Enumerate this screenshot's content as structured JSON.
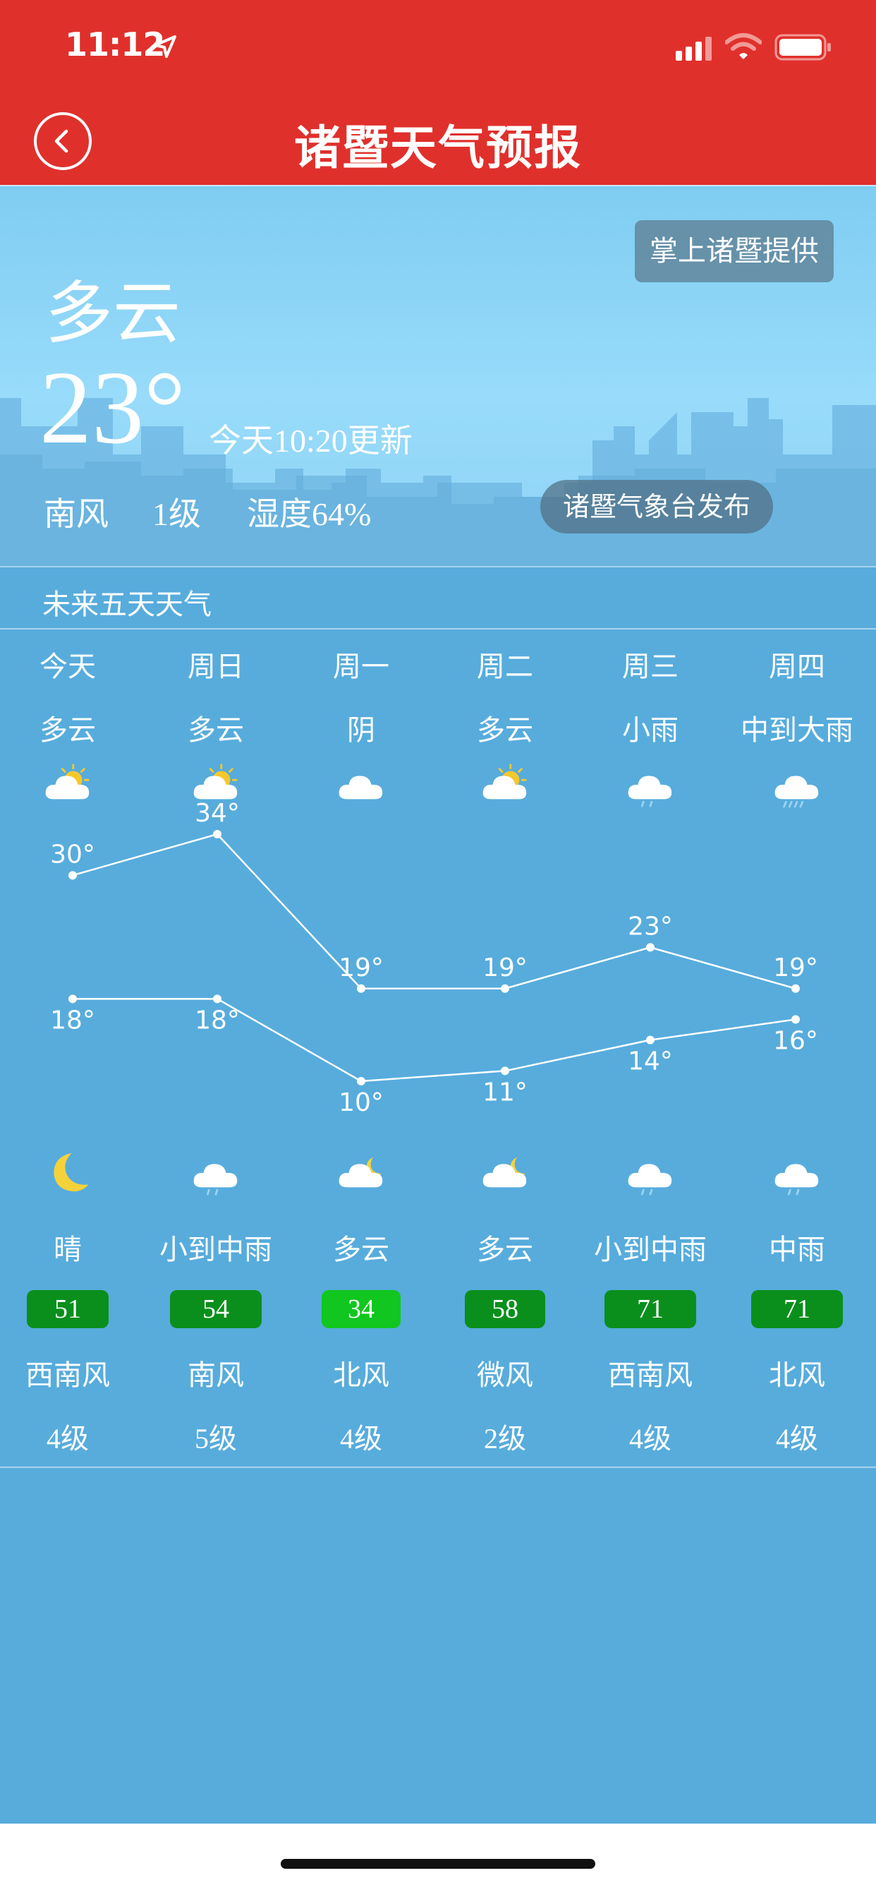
{
  "status_bar": {
    "time": "11:12",
    "location_icon": "location-arrow-icon",
    "signal_icon": "cellular-signal-icon",
    "wifi_icon": "wifi-icon",
    "battery_icon": "battery-icon"
  },
  "nav": {
    "title": "诸暨天气预报",
    "back_icon": "back-chevron-icon",
    "color": "#e0302c"
  },
  "current": {
    "condition": "多云",
    "temperature": "23°",
    "update_time": "今天10:20更新",
    "wind_direction": "南风",
    "wind_level": "1级",
    "humidity": "湿度64%",
    "provider": "掌上诸暨提供",
    "publisher": "诸暨气象台发布"
  },
  "forecast": {
    "section_title": "未来五天天气",
    "days": [
      {
        "name": "今天",
        "day_condition": "多云",
        "day_icon": "partly-cloudy-sun-icon",
        "night_icon": "crescent-moon-icon",
        "night_condition": "晴",
        "aqi": "51",
        "aqi_color": "#0a8f1c",
        "wind_direction": "西南风",
        "wind_level": "4级"
      },
      {
        "name": "周日",
        "day_condition": "多云",
        "day_icon": "partly-cloudy-sun-icon",
        "night_icon": "cloud-rain-icon",
        "night_condition": "小到中雨",
        "aqi": "54",
        "aqi_color": "#0a8f1c",
        "wind_direction": "南风",
        "wind_level": "5级"
      },
      {
        "name": "周一",
        "day_condition": "阴",
        "day_icon": "cloud-icon",
        "night_icon": "cloudy-night-icon",
        "night_condition": "多云",
        "aqi": "34",
        "aqi_color": "#11c61f",
        "wind_direction": "北风",
        "wind_level": "4级"
      },
      {
        "name": "周二",
        "day_condition": "多云",
        "day_icon": "partly-cloudy-sun-icon",
        "night_icon": "cloudy-night-icon",
        "night_condition": "多云",
        "aqi": "58",
        "aqi_color": "#0a8f1c",
        "wind_direction": "微风",
        "wind_level": "2级"
      },
      {
        "name": "周三",
        "day_condition": "小雨",
        "day_icon": "cloud-rain-icon",
        "night_icon": "cloud-rain-icon",
        "night_condition": "小到中雨",
        "aqi": "71",
        "aqi_color": "#0a8f1c",
        "wind_direction": "西南风",
        "wind_level": "4级"
      },
      {
        "name": "周四",
        "day_condition": "中到大雨",
        "day_icon": "cloud-heavy-rain-icon",
        "night_icon": "cloud-rain-icon",
        "night_condition": "中雨",
        "aqi": "71",
        "aqi_color": "#0a8f1c",
        "wind_direction": "北风",
        "wind_level": "4级"
      }
    ]
  },
  "chart_data": {
    "type": "line",
    "categories": [
      "今天",
      "周日",
      "周一",
      "周二",
      "周三",
      "周四"
    ],
    "series": [
      {
        "values": [
          30,
          34,
          19,
          19,
          23,
          19
        ],
        "labels": [
          "30°",
          "34°",
          "19°",
          "19°",
          "23°",
          "19°"
        ]
      },
      {
        "values": [
          18,
          18,
          10,
          11,
          14,
          16
        ],
        "labels": [
          "18°",
          "18°",
          "10°",
          "11°",
          "14°",
          "16°"
        ]
      }
    ],
    "title": "",
    "xlabel": "",
    "ylabel": "",
    "ylim": [
      10,
      34
    ],
    "grid": false,
    "line_color": "#ffffff"
  },
  "colors": {
    "sky_top": "#7fcdf2",
    "forecast_bg": "#57acdc",
    "aqi_good": "#0a8f1c",
    "aqi_excellent": "#11c61f"
  }
}
